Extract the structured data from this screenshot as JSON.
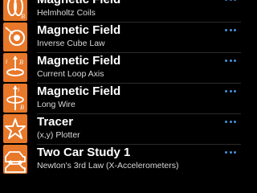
{
  "items": [
    {
      "title": "Magnetic Field",
      "subtitle": "Helmholtz Coils",
      "icon": "helmholtz-coils-icon"
    },
    {
      "title": "Magnetic Field",
      "subtitle": "Inverse Cube Law",
      "icon": "inverse-cube-law-icon"
    },
    {
      "title": "Magnetic Field",
      "subtitle": "Current Loop Axis",
      "icon": "current-loop-icon"
    },
    {
      "title": "Magnetic Field",
      "subtitle": "Long Wire",
      "icon": "long-wire-icon"
    },
    {
      "title": "Tracer",
      "subtitle": "(x,y) Plotter",
      "icon": "star-icon"
    },
    {
      "title": "Two Car Study 1",
      "subtitle": "Newton's 3rd Law (X-Accelerometers)",
      "icon": "car-icon"
    }
  ],
  "colors": {
    "background": "#000000",
    "icon_tile": "#e8782a",
    "title_text": "#ffffff",
    "subtitle_text": "#d8d8d8",
    "more_dots": "#4a90d9"
  }
}
